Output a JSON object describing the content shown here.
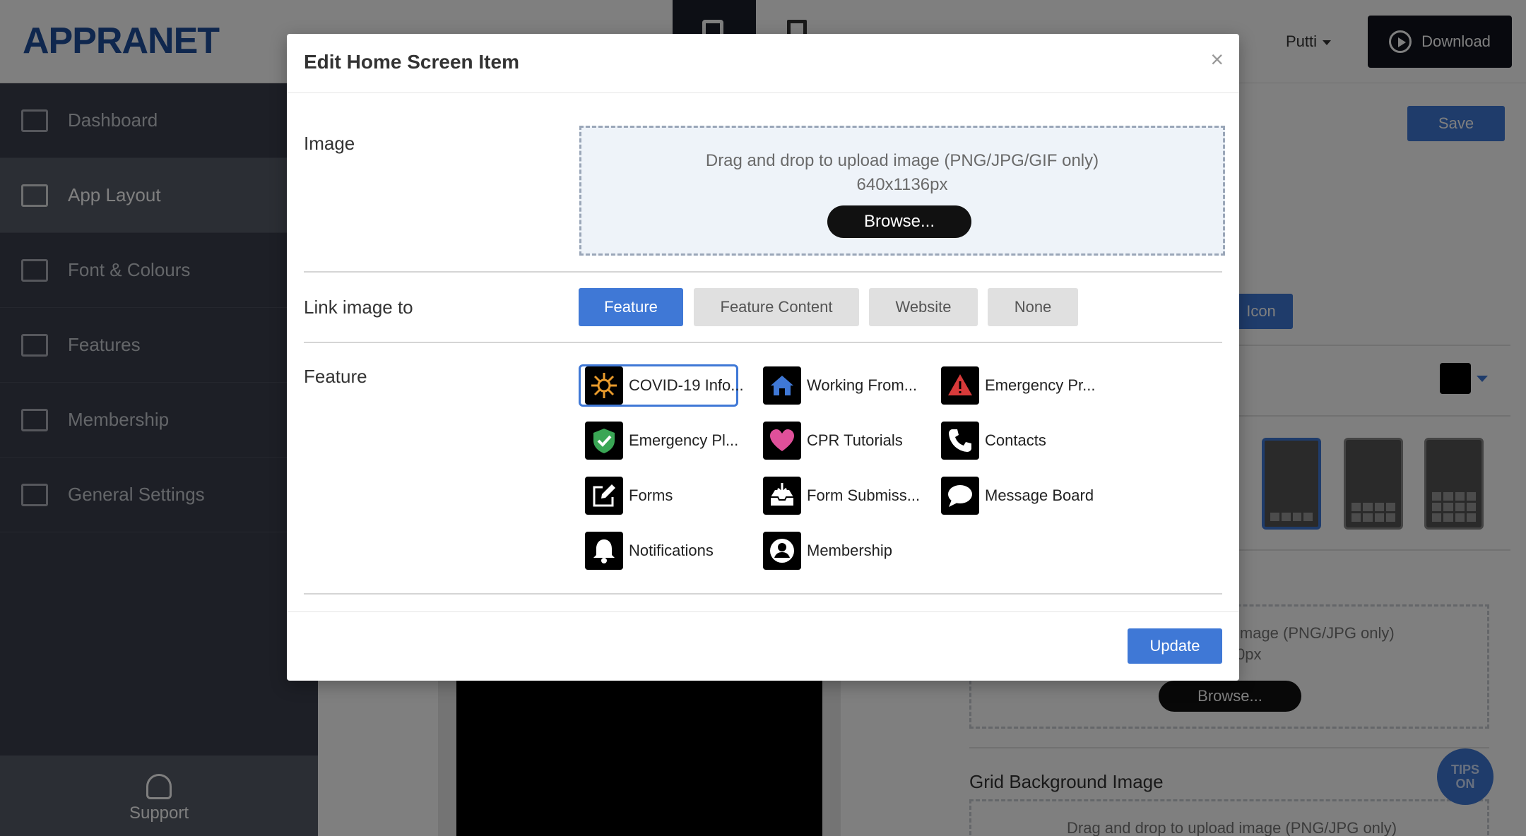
{
  "app": {
    "logo": "APPRANET",
    "user": "Putti",
    "download_label": "Download",
    "save_label": "Save",
    "icon_label": "Icon",
    "support_label": "Support",
    "tips_label_1": "TIPS",
    "tips_label_2": "ON",
    "bg_drop_text_1": "image (PNG/JPG only)",
    "bg_drop_text_2": "0px",
    "bg_browse_label": "Browse...",
    "grid_bg_title": "Grid Background Image",
    "grid_bg_drop_text": "Drag and drop to upload image (PNG/JPG only)",
    "swatch_color": "#000000"
  },
  "sidebar": {
    "items": [
      {
        "label": "Dashboard",
        "icon": "chart-icon"
      },
      {
        "label": "App Layout",
        "icon": "layout-icon"
      },
      {
        "label": "Font & Colours",
        "icon": "pencil-icon"
      },
      {
        "label": "Features",
        "icon": "features-icon"
      },
      {
        "label": "Membership",
        "icon": "id-card-icon"
      },
      {
        "label": "General Settings",
        "icon": "tools-icon"
      }
    ]
  },
  "modal": {
    "title": "Edit Home Screen Item",
    "close_label": "×",
    "image_label": "Image",
    "drop_text": "Drag and drop to upload image (PNG/JPG/GIF only)",
    "drop_size": "640x1136px",
    "browse_label": "Browse...",
    "link_label": "Link image to",
    "link_options": [
      "Feature",
      "Feature Content",
      "Website",
      "None"
    ],
    "link_selected": "Feature",
    "feature_label": "Feature",
    "features": [
      {
        "label": "COVID-19 Info...",
        "icon": "virus-icon",
        "color": "#e89a2c",
        "selected": true
      },
      {
        "label": "Working From...",
        "icon": "home-icon",
        "color": "#3f78d6"
      },
      {
        "label": "Emergency Pr...",
        "icon": "warning-icon",
        "color": "#d83a3a"
      },
      {
        "label": "Emergency Pl...",
        "icon": "shield-check-icon",
        "color": "#3aa655"
      },
      {
        "label": "CPR Tutorials",
        "icon": "heart-icon",
        "color": "#e0509a"
      },
      {
        "label": "Contacts",
        "icon": "phone-icon",
        "color": "#ffffff"
      },
      {
        "label": "Forms",
        "icon": "edit-form-icon",
        "color": "#ffffff"
      },
      {
        "label": "Form Submiss...",
        "icon": "inbox-icon",
        "color": "#ffffff"
      },
      {
        "label": "Message Board",
        "icon": "chat-bubble-icon",
        "color": "#ffffff"
      },
      {
        "label": "Notifications",
        "icon": "bell-icon",
        "color": "#ffffff"
      },
      {
        "label": "Membership",
        "icon": "user-circle-icon",
        "color": "#ffffff"
      }
    ],
    "update_label": "Update"
  }
}
